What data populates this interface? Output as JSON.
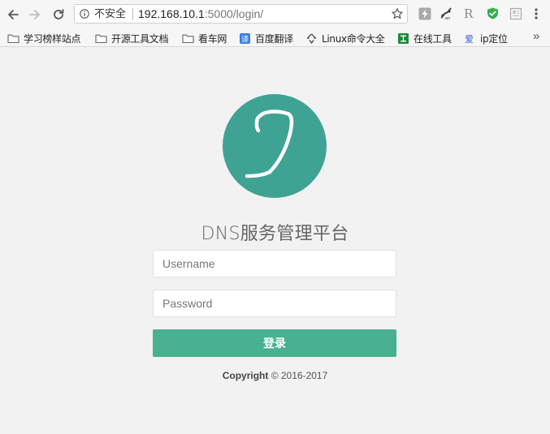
{
  "browser": {
    "address": {
      "security_label": "不安全",
      "url_host": "192.168.10.1",
      "url_path": ":5000/login/"
    },
    "extensions": [
      "lightning-extension-icon",
      "tracker-extension-icon",
      "r-extension-icon",
      "shield-extension-icon",
      "note-extension-icon"
    ],
    "bookmarks": [
      {
        "label": "学习榜样站点",
        "icon": "folder-icon"
      },
      {
        "label": "开源工具文档",
        "icon": "folder-icon"
      },
      {
        "label": "看车网",
        "icon": "folder-icon"
      },
      {
        "label": "百度翻译",
        "icon": "translate-icon"
      },
      {
        "label": "Linux命令大全",
        "icon": "linux-icon"
      },
      {
        "label": "在线工具",
        "icon": "tools-icon"
      },
      {
        "label": "ip定位",
        "icon": "location-icon"
      }
    ],
    "more_label": "»"
  },
  "login": {
    "title": "DNS服务管理平台",
    "username_placeholder": "Username",
    "password_placeholder": "Password",
    "submit_label": "登录",
    "copyright_bold": "Copyright",
    "copyright_rest": " © 2016-2017"
  },
  "colors": {
    "brand": "#47b190",
    "logo_bg": "#3fa394",
    "page_bg": "#f2f2f2"
  }
}
